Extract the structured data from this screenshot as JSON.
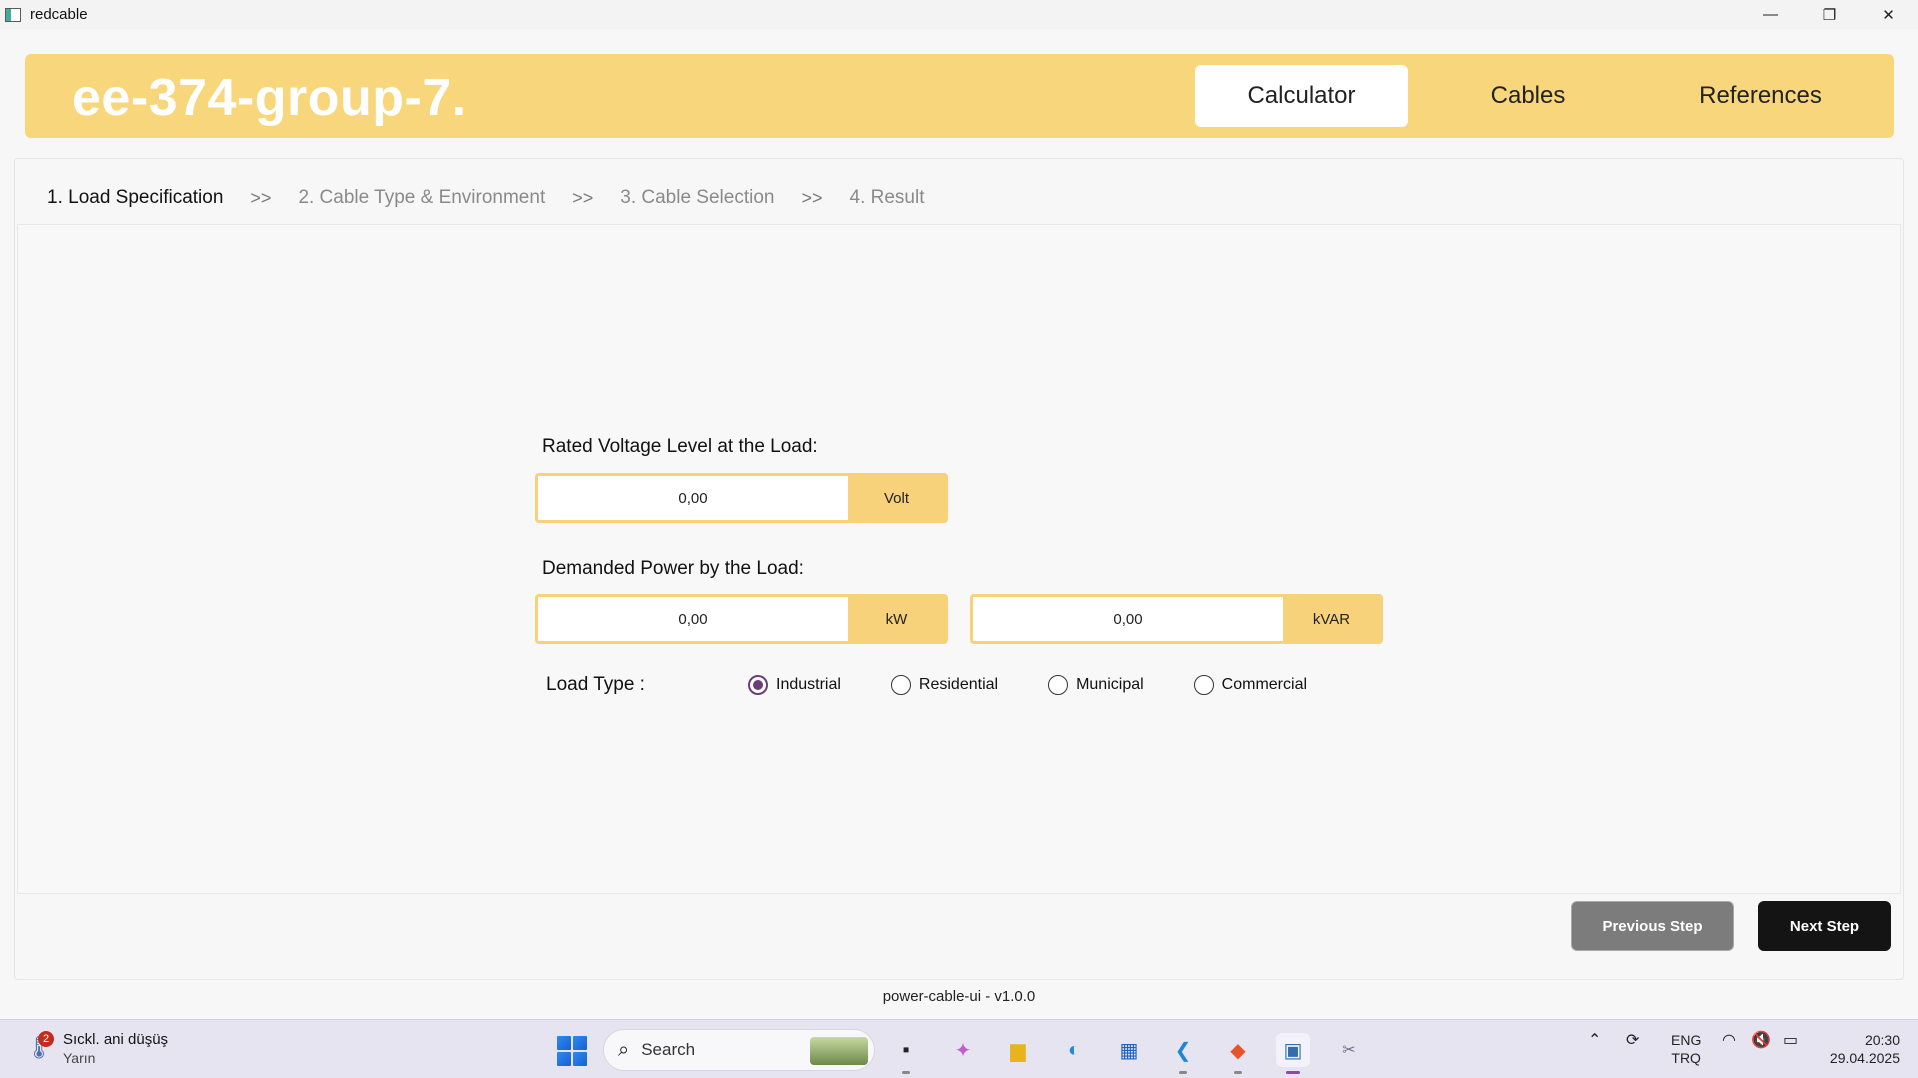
{
  "window": {
    "title": "redcable",
    "minimize_glyph": "—",
    "maximize_glyph": "❐",
    "close_glyph": "✕"
  },
  "header": {
    "brand": "ee-374-group-7.",
    "nav": [
      {
        "label": "Calculator",
        "active": true
      },
      {
        "label": "Cables",
        "active": false
      },
      {
        "label": "References",
        "active": false
      }
    ]
  },
  "steps": {
    "items": [
      {
        "label": "1. Load Specification",
        "active": true
      },
      {
        "label": "2. Cable Type & Environment",
        "active": false
      },
      {
        "label": "3. Cable Selection",
        "active": false
      },
      {
        "label": "4. Result",
        "active": false
      }
    ],
    "separator": ">>"
  },
  "form": {
    "voltage_label": "Rated Voltage Level at the Load:",
    "voltage_value": "0,00",
    "voltage_unit": "Volt",
    "power_label": "Demanded Power by the Load:",
    "active_power_value": "0,00",
    "active_power_unit": "kW",
    "reactive_power_value": "0,00",
    "reactive_power_unit": "kVAR",
    "load_type_label": "Load Type :",
    "load_types": [
      {
        "label": "Industrial",
        "checked": true
      },
      {
        "label": "Residential",
        "checked": false
      },
      {
        "label": "Municipal",
        "checked": false
      },
      {
        "label": "Commercial",
        "checked": false
      }
    ]
  },
  "buttons": {
    "previous": "Previous Step",
    "next": "Next Step"
  },
  "version": "power-cable-ui - v1.0.0",
  "taskbar": {
    "weather_badge": "2",
    "weather_title": "Sıckl. ani düşüş",
    "weather_subtitle": "Yarın",
    "search_placeholder": "Search",
    "lang_top": "ENG",
    "lang_bottom": "TRQ",
    "time": "20:30",
    "date": "29.04.2025"
  },
  "colors": {
    "accent": "#f8d67b",
    "unit_bg": "#f7d27a",
    "radio_checked": "#6a3d7a",
    "prev_button": "#7c7c7c",
    "next_button": "#141414"
  }
}
